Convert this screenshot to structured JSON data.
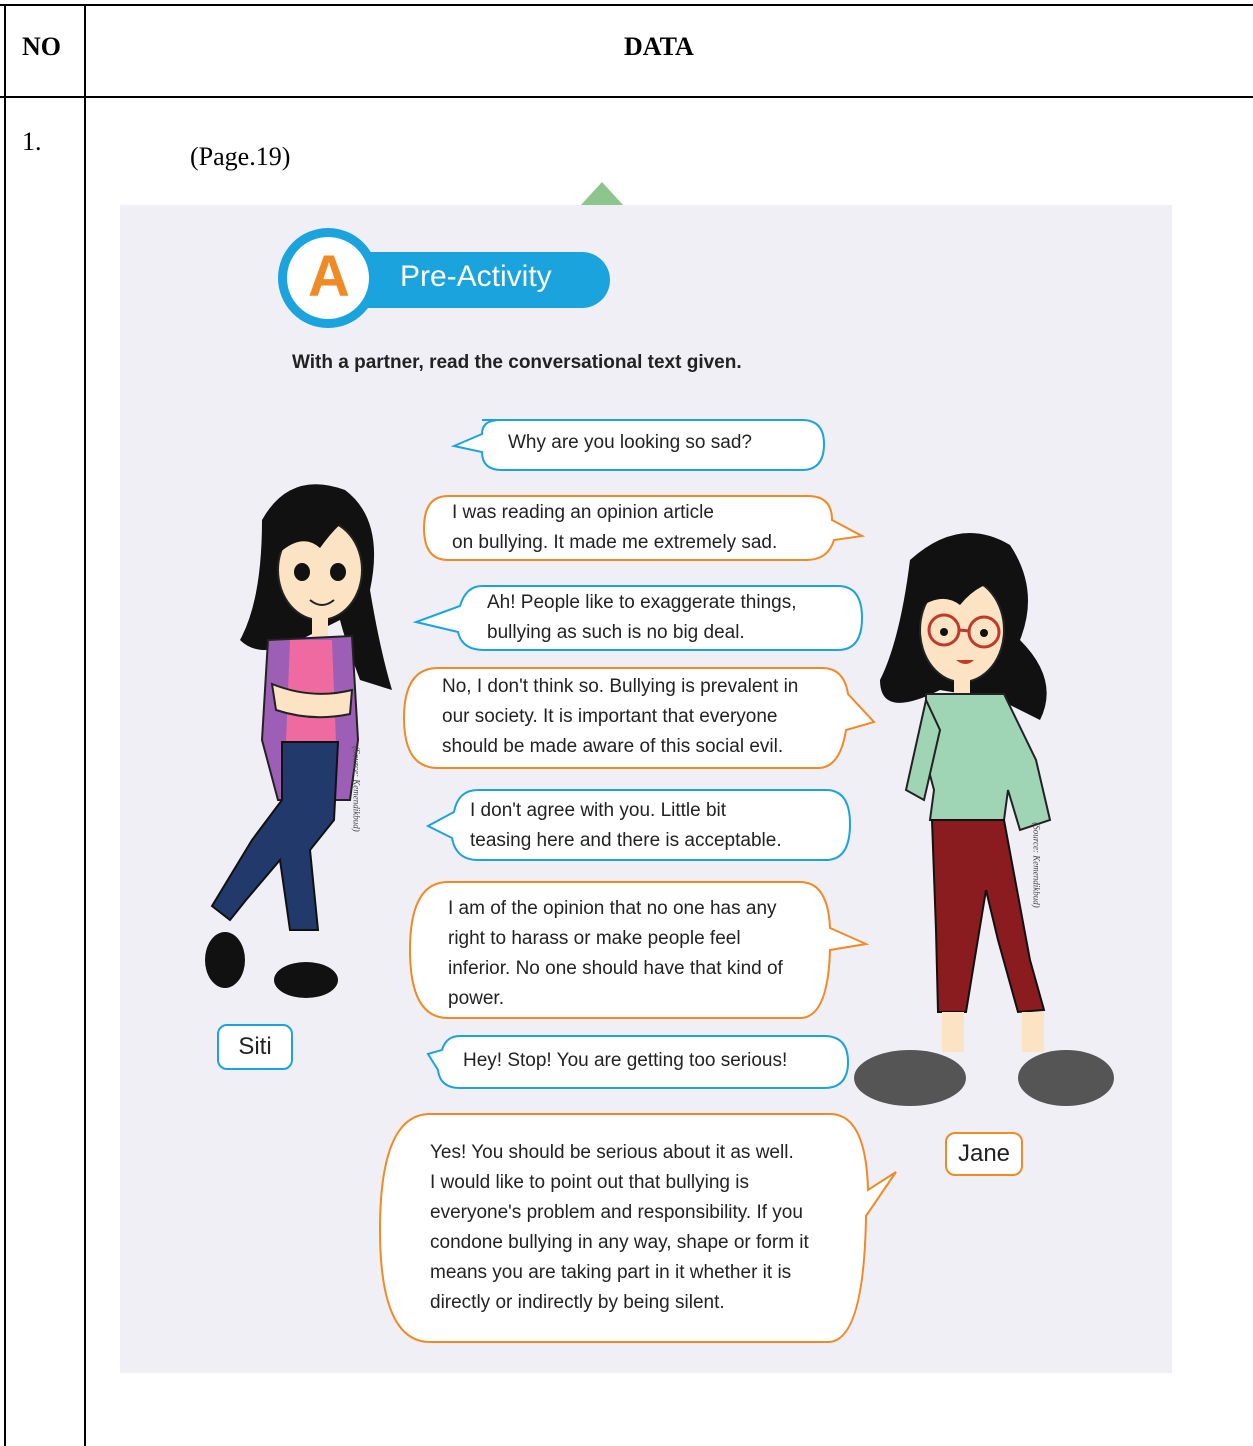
{
  "table": {
    "col_no_header": "NO",
    "col_data_header": "DATA",
    "row_number": "1.",
    "page_reference": "(Page.19)"
  },
  "activity": {
    "badge_letter": "A",
    "title": "Pre-Activity",
    "instruction": "With a partner, read the conversational text given."
  },
  "colors": {
    "blue_accent": "#1ba3dd",
    "orange_accent": "#f08a24",
    "panel_bg": "#f0eff5"
  },
  "characters": {
    "left_name": "Siti",
    "right_name": "Jane",
    "left_credit": "(Source: Kemendikbud)",
    "right_credit": "(Source: Kemendikbud)"
  },
  "dialogue": [
    {
      "speaker": "Jane",
      "lines": [
        "Why are you looking so sad?"
      ]
    },
    {
      "speaker": "Siti",
      "lines": [
        "I was reading an opinion article",
        "on bullying. It made me extremely sad."
      ]
    },
    {
      "speaker": "Jane",
      "lines": [
        "Ah! People like to exaggerate things,",
        "bullying as such is no big deal."
      ]
    },
    {
      "speaker": "Siti",
      "lines": [
        "No, I don't think so. Bullying is prevalent in",
        "our society. It is important that everyone",
        "should be made aware of this social evil."
      ]
    },
    {
      "speaker": "Jane",
      "lines": [
        "I don't agree with you. Little bit",
        "teasing here and there is acceptable."
      ]
    },
    {
      "speaker": "Siti",
      "lines": [
        "I am of the opinion that no one has any",
        "right to harass or make people feel",
        "inferior. No one should have that kind of",
        "power."
      ]
    },
    {
      "speaker": "Jane",
      "lines": [
        "Hey! Stop! You are getting too serious!"
      ]
    },
    {
      "speaker": "Siti",
      "lines": [
        "Yes! You should be serious about it as well.",
        "I would like to point out that bullying is",
        "everyone's problem and responsibility. If you",
        "condone bullying in any way, shape or form it",
        "means you are taking part in it whether it is",
        "directly or indirectly by being silent."
      ]
    }
  ]
}
